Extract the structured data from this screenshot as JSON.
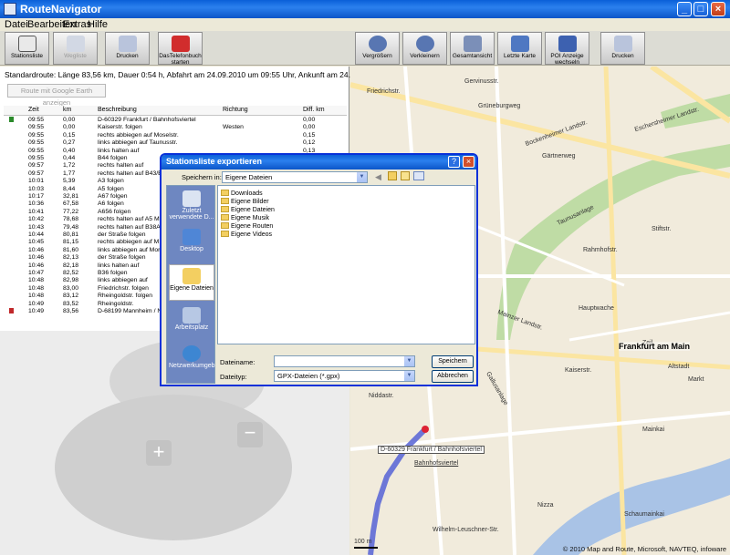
{
  "window": {
    "title": "RouteNavigator"
  },
  "menu": [
    "Datei",
    "Bearbeiten",
    "Extras",
    "Hilfe"
  ],
  "toolbar": {
    "left": [
      "Stationsliste",
      "Wegliste",
      "Drucken",
      "DasTelefonbuch starten"
    ],
    "right": [
      "Vergrößern",
      "Verkleinern",
      "Gesamtansicht",
      "Letzte Karte",
      "POI Anzeige wechseln",
      "Drucken"
    ]
  },
  "route": {
    "summary": "Standardroute: Länge 83,56 km, Dauer 0:54 h, Abfahrt am 24.09.2010 um 09:55 Uhr, Ankunft am 24.09.2010 um 10:49",
    "google_earth_button": "Route mit Google Earth anzeigen",
    "columns": [
      "Zeit",
      "km",
      "Beschreibung",
      "Richtung",
      "Diff. km"
    ],
    "rows": [
      {
        "time": "09:55",
        "km": "0,00",
        "desc": "D-60329 Frankfurt / Bahnhofsviertel",
        "dir": "",
        "diff": "0,00"
      },
      {
        "time": "09:55",
        "km": "0,00",
        "desc": "Kaiserstr. folgen",
        "dir": "Westen",
        "diff": "0,00"
      },
      {
        "time": "09:55",
        "km": "0,15",
        "desc": "rechts abbiegen auf Moselstr.",
        "dir": "",
        "diff": "0,15"
      },
      {
        "time": "09:55",
        "km": "0,27",
        "desc": "links abbiegen auf Taunusstr.",
        "dir": "",
        "diff": "0,12"
      },
      {
        "time": "09:55",
        "km": "0,40",
        "desc": "links halten auf",
        "dir": "",
        "diff": "0,13"
      },
      {
        "time": "09:55",
        "km": "0,44",
        "desc": "B44 folgen",
        "dir": "",
        "diff": ""
      },
      {
        "time": "09:57",
        "km": "1,72",
        "desc": "rechts halten auf",
        "dir": "",
        "diff": ""
      },
      {
        "time": "09:57",
        "km": "1,77",
        "desc": "rechts halten auf B43/B44",
        "dir": "",
        "diff": ""
      },
      {
        "time": "10:01",
        "km": "5,39",
        "desc": "A3 folgen",
        "dir": "",
        "diff": ""
      },
      {
        "time": "10:03",
        "km": "8,44",
        "desc": "A5 folgen",
        "dir": "",
        "diff": ""
      },
      {
        "time": "10:17",
        "km": "32,81",
        "desc": "A67 folgen",
        "dir": "",
        "diff": ""
      },
      {
        "time": "10:36",
        "km": "67,58",
        "desc": "A6 folgen",
        "dir": "",
        "diff": ""
      },
      {
        "time": "10:41",
        "km": "77,22",
        "desc": "A656 folgen",
        "dir": "",
        "diff": ""
      },
      {
        "time": "10:42",
        "km": "78,68",
        "desc": "rechts halten auf A5 M",
        "dir": "",
        "diff": ""
      },
      {
        "time": "10:43",
        "km": "79,48",
        "desc": "rechts halten auf B38A",
        "dir": "",
        "diff": ""
      },
      {
        "time": "10:44",
        "km": "80,81",
        "desc": "der Straße folgen",
        "dir": "",
        "diff": ""
      },
      {
        "time": "10:45",
        "km": "81,15",
        "desc": "rechts abbiegen auf M",
        "dir": "",
        "diff": ""
      },
      {
        "time": "10:46",
        "km": "81,60",
        "desc": "links abbiegen auf Moro",
        "dir": "",
        "diff": ""
      },
      {
        "time": "10:46",
        "km": "82,13",
        "desc": "der Straße folgen",
        "dir": "",
        "diff": ""
      },
      {
        "time": "10:46",
        "km": "82,18",
        "desc": "links halten auf",
        "dir": "",
        "diff": ""
      },
      {
        "time": "10:47",
        "km": "82,52",
        "desc": "B36 folgen",
        "dir": "",
        "diff": ""
      },
      {
        "time": "10:48",
        "km": "82,98",
        "desc": "links abbiegen auf",
        "dir": "",
        "diff": ""
      },
      {
        "time": "10:48",
        "km": "83,00",
        "desc": "Friedrichstr. folgen",
        "dir": "",
        "diff": ""
      },
      {
        "time": "10:48",
        "km": "83,12",
        "desc": "Rheingoldstr. folgen",
        "dir": "",
        "diff": ""
      },
      {
        "time": "10:49",
        "km": "83,52",
        "desc": "Rheingoldstr.",
        "dir": "",
        "diff": ""
      },
      {
        "time": "10:49",
        "km": "83,56",
        "desc": "D-68199 Mannheim / N",
        "dir": "",
        "diff": ""
      }
    ]
  },
  "map": {
    "city": "Frankfurt am Main",
    "start_label": "D-60329 Frankfurt / Bahnhofsviertel",
    "scale": "100 m",
    "copyright": "© 2010 Map and Route, Microsoft, NAVTEQ, infoware",
    "labels": [
      "Gervinusstr.",
      "Friedrichstr.",
      "Grüneburgweg",
      "Bockenheimer Landstr.",
      "Gärtnerweg",
      "Eschersheimer Landstr.",
      "Mainzer Landstr.",
      "Taunusanlage",
      "Rahmhofstr.",
      "Hauptwache",
      "Altstadt",
      "Markt",
      "Gallusanlage",
      "Kaiserstr.",
      "Niddastr.",
      "Nizza",
      "Mainkai",
      "Schaumainkai",
      "Bahnhofsviertel",
      "Stiftstr.",
      "Zeil",
      "Wilhelm-Leuschner-Str."
    ]
  },
  "dialog": {
    "title": "Stationsliste exportieren",
    "save_in_label": "Speichern in:",
    "save_in_value": "Eigene Dateien",
    "places": [
      "Zuletzt verwendete D...",
      "Desktop",
      "Eigene Dateien",
      "Arbeitsplatz",
      "Netzwerkumgeb"
    ],
    "files": [
      "Downloads",
      "Eigene Bilder",
      "Eigene Dateien",
      "Eigene Musik",
      "Eigene Routen",
      "Eigene Videos"
    ],
    "filename_label": "Dateiname:",
    "filename_value": "",
    "filetype_label": "Dateityp:",
    "filetype_value": "GPX-Dateien (*.gpx)",
    "save_button": "Speichern",
    "cancel_button": "Abbrechen"
  }
}
